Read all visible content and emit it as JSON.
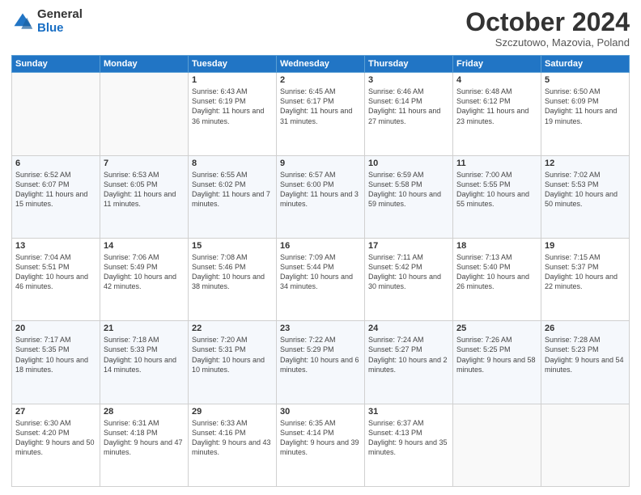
{
  "logo": {
    "general": "General",
    "blue": "Blue"
  },
  "header": {
    "month": "October 2024",
    "location": "Szczutowo, Mazovia, Poland"
  },
  "weekdays": [
    "Sunday",
    "Monday",
    "Tuesday",
    "Wednesday",
    "Thursday",
    "Friday",
    "Saturday"
  ],
  "weeks": [
    [
      {
        "day": "",
        "info": ""
      },
      {
        "day": "",
        "info": ""
      },
      {
        "day": "1",
        "info": "Sunrise: 6:43 AM\nSunset: 6:19 PM\nDaylight: 11 hours and 36 minutes."
      },
      {
        "day": "2",
        "info": "Sunrise: 6:45 AM\nSunset: 6:17 PM\nDaylight: 11 hours and 31 minutes."
      },
      {
        "day": "3",
        "info": "Sunrise: 6:46 AM\nSunset: 6:14 PM\nDaylight: 11 hours and 27 minutes."
      },
      {
        "day": "4",
        "info": "Sunrise: 6:48 AM\nSunset: 6:12 PM\nDaylight: 11 hours and 23 minutes."
      },
      {
        "day": "5",
        "info": "Sunrise: 6:50 AM\nSunset: 6:09 PM\nDaylight: 11 hours and 19 minutes."
      }
    ],
    [
      {
        "day": "6",
        "info": "Sunrise: 6:52 AM\nSunset: 6:07 PM\nDaylight: 11 hours and 15 minutes."
      },
      {
        "day": "7",
        "info": "Sunrise: 6:53 AM\nSunset: 6:05 PM\nDaylight: 11 hours and 11 minutes."
      },
      {
        "day": "8",
        "info": "Sunrise: 6:55 AM\nSunset: 6:02 PM\nDaylight: 11 hours and 7 minutes."
      },
      {
        "day": "9",
        "info": "Sunrise: 6:57 AM\nSunset: 6:00 PM\nDaylight: 11 hours and 3 minutes."
      },
      {
        "day": "10",
        "info": "Sunrise: 6:59 AM\nSunset: 5:58 PM\nDaylight: 10 hours and 59 minutes."
      },
      {
        "day": "11",
        "info": "Sunrise: 7:00 AM\nSunset: 5:55 PM\nDaylight: 10 hours and 55 minutes."
      },
      {
        "day": "12",
        "info": "Sunrise: 7:02 AM\nSunset: 5:53 PM\nDaylight: 10 hours and 50 minutes."
      }
    ],
    [
      {
        "day": "13",
        "info": "Sunrise: 7:04 AM\nSunset: 5:51 PM\nDaylight: 10 hours and 46 minutes."
      },
      {
        "day": "14",
        "info": "Sunrise: 7:06 AM\nSunset: 5:49 PM\nDaylight: 10 hours and 42 minutes."
      },
      {
        "day": "15",
        "info": "Sunrise: 7:08 AM\nSunset: 5:46 PM\nDaylight: 10 hours and 38 minutes."
      },
      {
        "day": "16",
        "info": "Sunrise: 7:09 AM\nSunset: 5:44 PM\nDaylight: 10 hours and 34 minutes."
      },
      {
        "day": "17",
        "info": "Sunrise: 7:11 AM\nSunset: 5:42 PM\nDaylight: 10 hours and 30 minutes."
      },
      {
        "day": "18",
        "info": "Sunrise: 7:13 AM\nSunset: 5:40 PM\nDaylight: 10 hours and 26 minutes."
      },
      {
        "day": "19",
        "info": "Sunrise: 7:15 AM\nSunset: 5:37 PM\nDaylight: 10 hours and 22 minutes."
      }
    ],
    [
      {
        "day": "20",
        "info": "Sunrise: 7:17 AM\nSunset: 5:35 PM\nDaylight: 10 hours and 18 minutes."
      },
      {
        "day": "21",
        "info": "Sunrise: 7:18 AM\nSunset: 5:33 PM\nDaylight: 10 hours and 14 minutes."
      },
      {
        "day": "22",
        "info": "Sunrise: 7:20 AM\nSunset: 5:31 PM\nDaylight: 10 hours and 10 minutes."
      },
      {
        "day": "23",
        "info": "Sunrise: 7:22 AM\nSunset: 5:29 PM\nDaylight: 10 hours and 6 minutes."
      },
      {
        "day": "24",
        "info": "Sunrise: 7:24 AM\nSunset: 5:27 PM\nDaylight: 10 hours and 2 minutes."
      },
      {
        "day": "25",
        "info": "Sunrise: 7:26 AM\nSunset: 5:25 PM\nDaylight: 9 hours and 58 minutes."
      },
      {
        "day": "26",
        "info": "Sunrise: 7:28 AM\nSunset: 5:23 PM\nDaylight: 9 hours and 54 minutes."
      }
    ],
    [
      {
        "day": "27",
        "info": "Sunrise: 6:30 AM\nSunset: 4:20 PM\nDaylight: 9 hours and 50 minutes."
      },
      {
        "day": "28",
        "info": "Sunrise: 6:31 AM\nSunset: 4:18 PM\nDaylight: 9 hours and 47 minutes."
      },
      {
        "day": "29",
        "info": "Sunrise: 6:33 AM\nSunset: 4:16 PM\nDaylight: 9 hours and 43 minutes."
      },
      {
        "day": "30",
        "info": "Sunrise: 6:35 AM\nSunset: 4:14 PM\nDaylight: 9 hours and 39 minutes."
      },
      {
        "day": "31",
        "info": "Sunrise: 6:37 AM\nSunset: 4:13 PM\nDaylight: 9 hours and 35 minutes."
      },
      {
        "day": "",
        "info": ""
      },
      {
        "day": "",
        "info": ""
      }
    ]
  ]
}
